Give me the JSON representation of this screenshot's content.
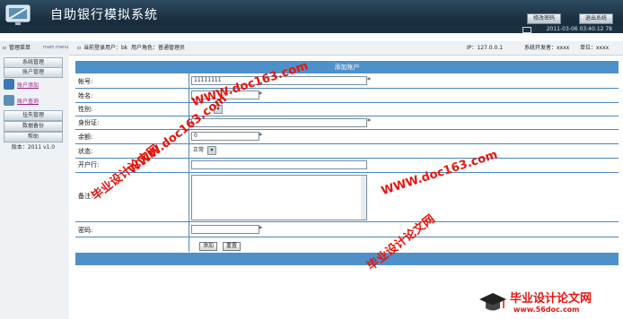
{
  "header": {
    "title": "自助银行模拟系统",
    "change_password": "修改密码",
    "logout": "退出系统",
    "datetime": "2011-03-06 03:40:12 78"
  },
  "infobar": {
    "menu_title": "管理菜单",
    "menu_sub": "main menu",
    "current_user": "当前登录用户：bk",
    "user_role": "用户角色：普通管理员",
    "ip": "IP：127.0.0.1",
    "developer": "系统开发者：xxxx",
    "unit": "单位：xxxx"
  },
  "sidebar": {
    "items": [
      "系统管理",
      "账户管理",
      "账户添加",
      "账户查询",
      "挂失管理",
      "数据备份",
      "帮助"
    ],
    "version": "版本：2011 v1.0"
  },
  "form": {
    "title": "添加账户",
    "account_label": "帐号:",
    "account_value": "11111111",
    "name_label": "姓名:",
    "gender_label": "性别:",
    "gender_value": "",
    "id_label": "身份证:",
    "balance_label": "余额:",
    "balance_value": "0",
    "status_label": "状态:",
    "status_value": "正常",
    "branch_label": "开户行:",
    "remark_label": "备注:",
    "password_label": "密码:",
    "add_button": "添加",
    "reset_button": "重置",
    "required_mark": "*"
  },
  "watermark": {
    "site": "WWW.doc163.com",
    "cn": "毕业设计论文网",
    "footer_cn": "毕业设计论文网",
    "footer_site": "www.56doc.com"
  },
  "colors": {
    "header_bg": "#1b3243",
    "form_header": "#4e90c9",
    "row_border": "#4a86bd",
    "watermark": "#e3150d",
    "link": "#a01d88"
  }
}
